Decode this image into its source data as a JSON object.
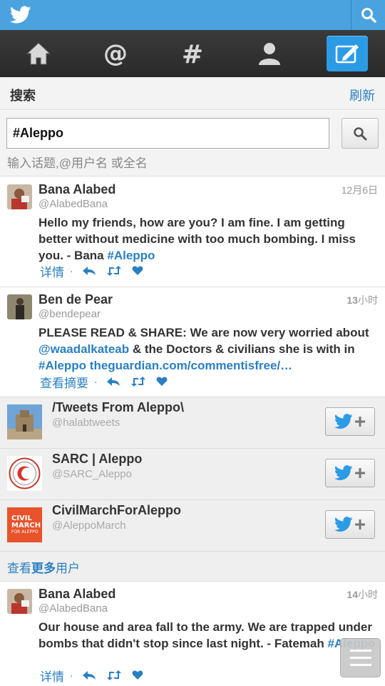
{
  "app": {
    "accent": "#4aa3df",
    "compose_color": "#2b9be6",
    "link_color": "#2a7fc1"
  },
  "nav": {
    "items": [
      {
        "icon": "home-icon"
      },
      {
        "icon": "mentions-icon"
      },
      {
        "icon": "hashtag-icon"
      },
      {
        "icon": "profile-icon"
      },
      {
        "icon": "compose-icon"
      }
    ]
  },
  "header": {
    "title": "搜索",
    "refresh_label": "刷新"
  },
  "search": {
    "value": "#Aleppo",
    "hint": "输入话题,@用户名 或全名"
  },
  "tweets": [
    {
      "name": "Bana Alabed",
      "handle": "@AlabedBana",
      "time": "12月6日",
      "text_before": "Hello my friends, how are you? I am fine. I am getting better without medicine with too much bombing. I miss you. - Bana ",
      "hashtag": "#Aleppo",
      "detail_label": "详情"
    },
    {
      "name": "Ben de Pear",
      "handle": "@bendepear",
      "time_num": "13",
      "time_unit": "小时",
      "text_1": "PLEASE READ & SHARE: We are now very worried about ",
      "mention": "@waadalkateab",
      "text_2": " & the Doctors & civilians she is with in ",
      "hashtag": "#Aleppo",
      "url": "theguardian.com/commentisfree/…",
      "detail_label": "查看摘要"
    },
    {
      "name": "Bana Alabed",
      "handle": "@AlabedBana",
      "time_num": "14",
      "time_unit": "小时",
      "text_before": "Our house and area fall to the army. We are trapped under bombs that didn't stop since last night. - Fatemah ",
      "hashtag": "#Aleppo",
      "detail_label": "详情"
    }
  ],
  "users": [
    {
      "name": "/Tweets From Aleppo\\",
      "handle": "@halabtweets"
    },
    {
      "name": "SARC | Aleppo",
      "handle": "@SARC_Aleppo"
    },
    {
      "name": "CivilMarchForAleppo",
      "handle": "@AleppoMarch"
    }
  ],
  "civil_logo": {
    "line1": "CIVIL",
    "line2": "MARCH",
    "line3": "FOR ALEPPO"
  },
  "more_users": {
    "prefix": "查看",
    "bold": "更多",
    "suffix": "用户"
  }
}
